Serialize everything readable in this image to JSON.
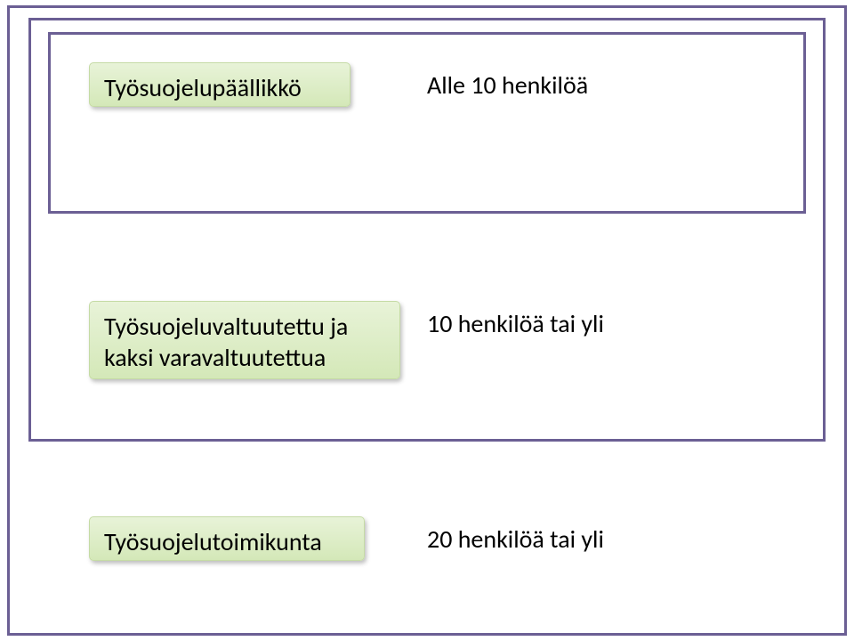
{
  "colors": {
    "border": "#6b5f94",
    "boxFillTop": "#e8f3d8",
    "boxFillBottom": "#d4e8b8"
  },
  "rows": [
    {
      "boxText": "Työsuojelupäällikkö",
      "labelText": "Alle 10 henkilöä"
    },
    {
      "boxText": "Työsuojeluvaltuutettu ja kaksi varavaltuutettua",
      "labelText": "10 henkilöä tai yli"
    },
    {
      "boxText": "Työsuojelutoimikunta",
      "labelText": "20 henkilöä tai yli"
    }
  ]
}
